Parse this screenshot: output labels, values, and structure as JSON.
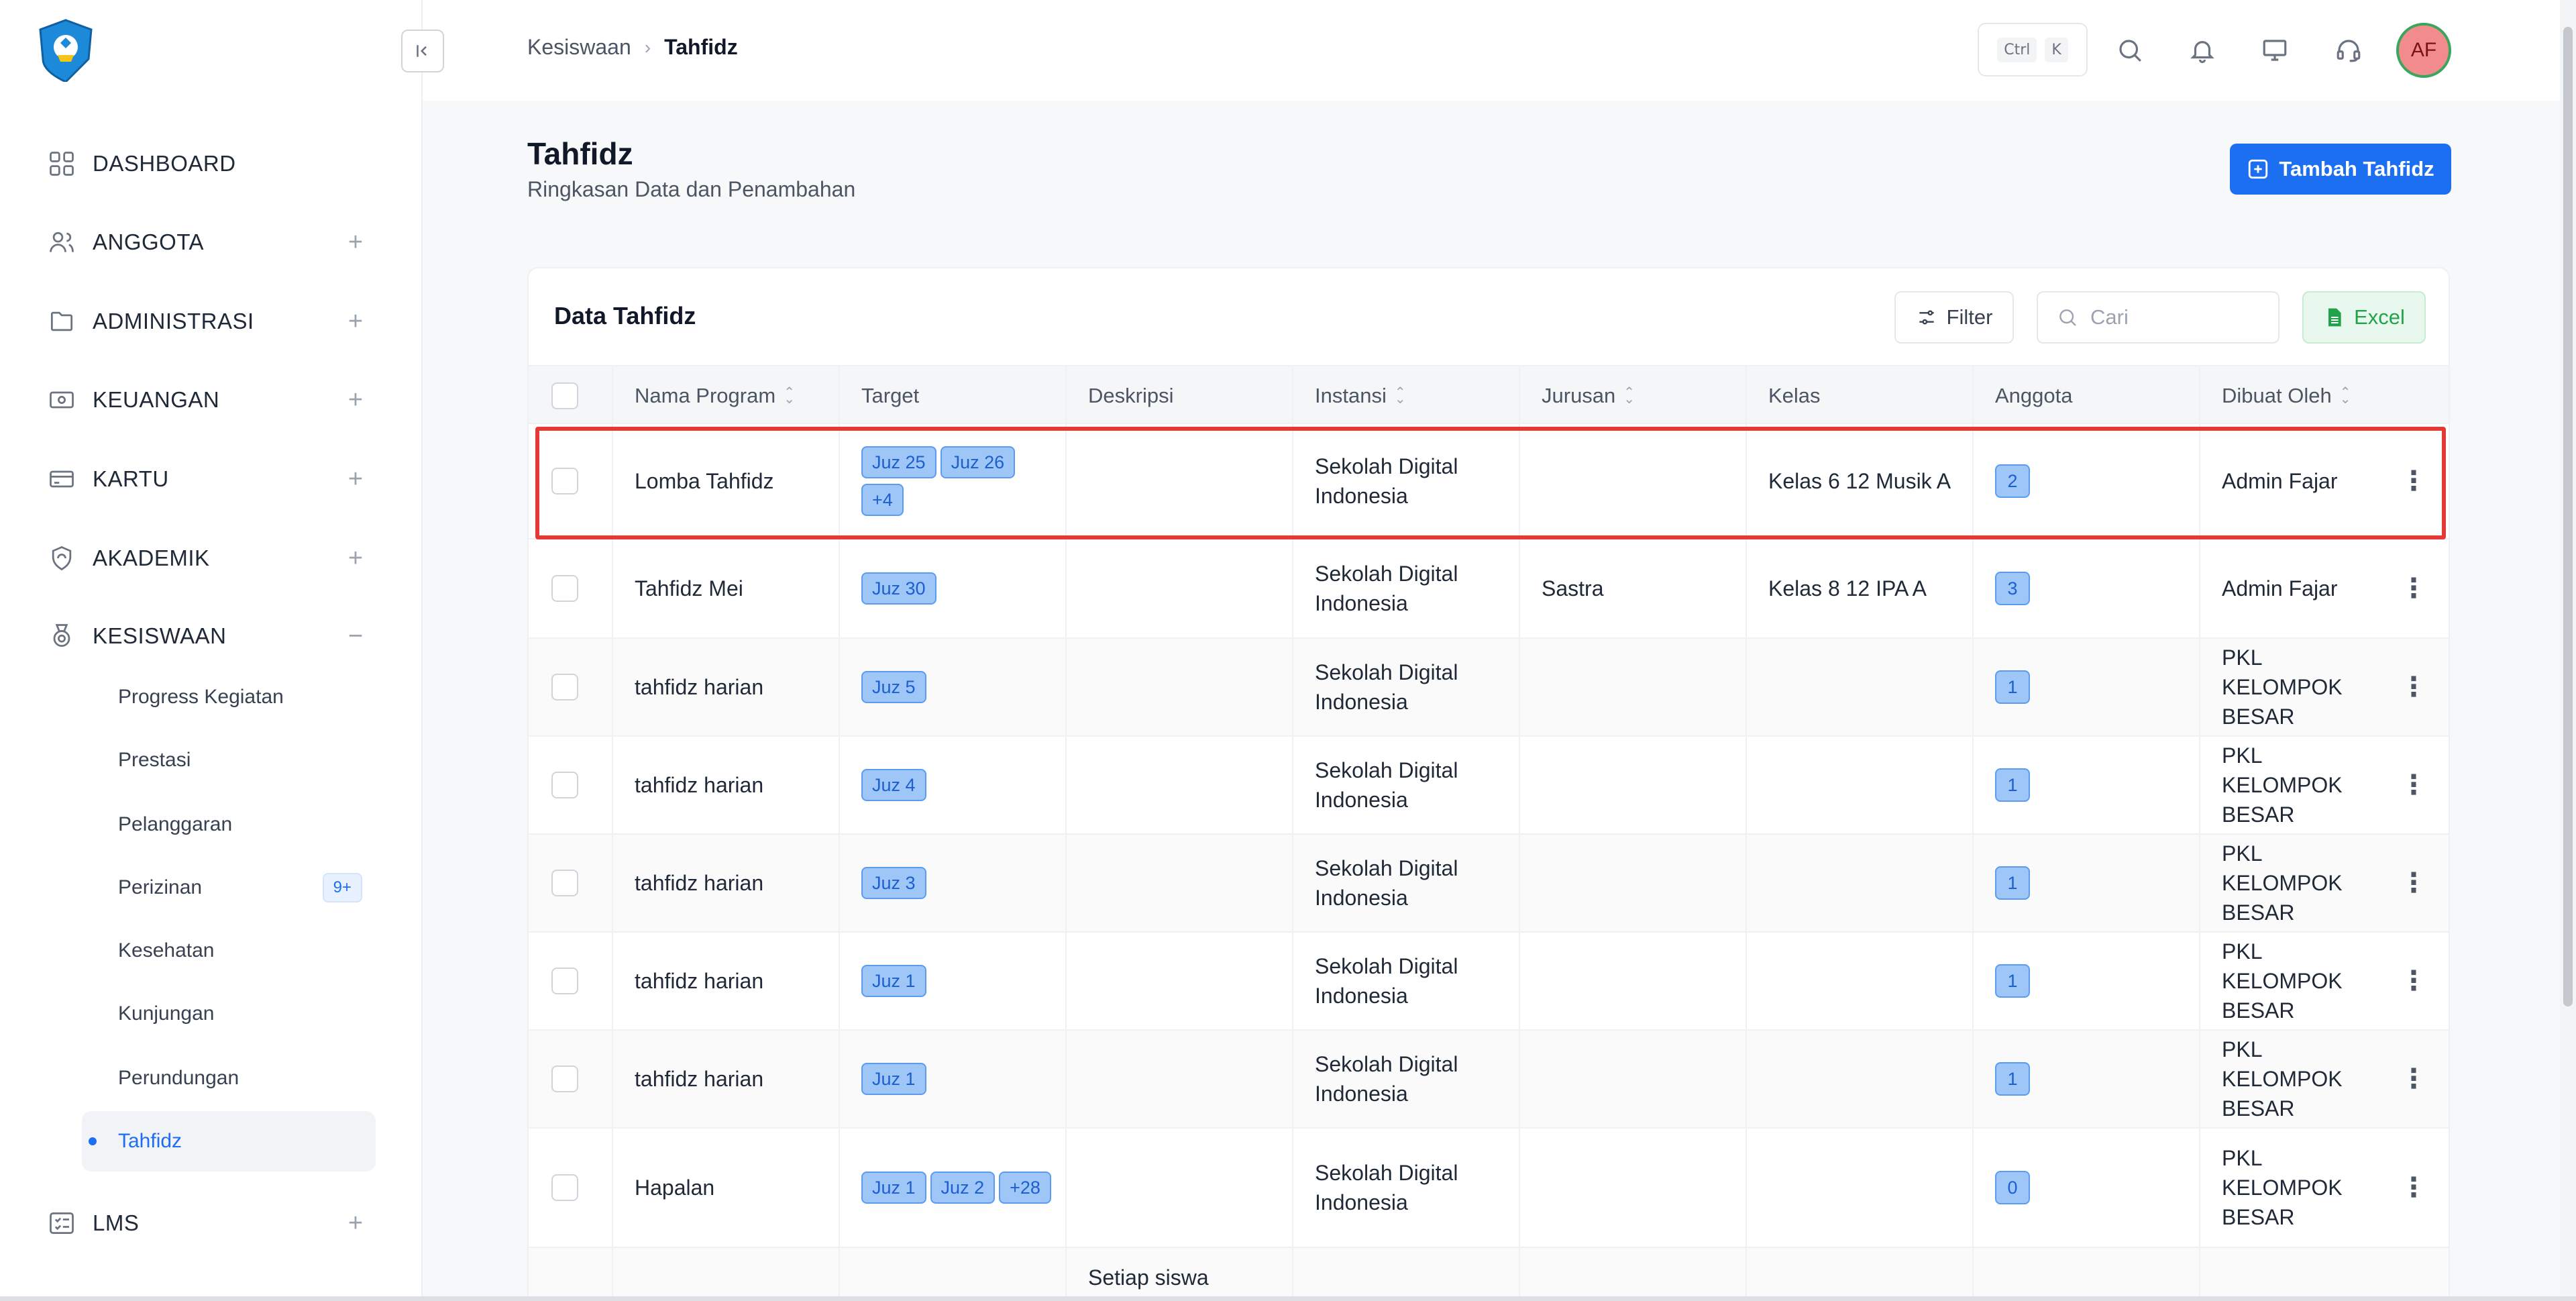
{
  "sidebar": {
    "nav": [
      {
        "label": "DASHBOARD",
        "icon": "grid-icon",
        "toggle": ""
      },
      {
        "label": "ANGGOTA",
        "icon": "users-icon",
        "toggle": "+"
      },
      {
        "label": "ADMINISTRASI",
        "icon": "folder-icon",
        "toggle": "+"
      },
      {
        "label": "KEUANGAN",
        "icon": "money-icon",
        "toggle": "+"
      },
      {
        "label": "KARTU",
        "icon": "card-icon",
        "toggle": "+"
      },
      {
        "label": "AKADEMIK",
        "icon": "shield-icon",
        "toggle": "+"
      },
      {
        "label": "KESISWAAN",
        "icon": "medal-icon",
        "toggle": "−"
      },
      {
        "label": "LMS",
        "icon": "checklist-icon",
        "toggle": "+"
      }
    ],
    "sub": [
      {
        "label": "Progress Kegiatan"
      },
      {
        "label": "Prestasi"
      },
      {
        "label": "Pelanggaran"
      },
      {
        "label": "Perizinan",
        "badge": "9+"
      },
      {
        "label": "Kesehatan"
      },
      {
        "label": "Kunjungan"
      },
      {
        "label": "Perundungan"
      },
      {
        "label": "Tahfidz"
      }
    ]
  },
  "topbar": {
    "breadcrumb": [
      "Kesiswaan",
      "Tahfidz"
    ],
    "kbd": [
      "Ctrl",
      "K"
    ],
    "avatar": "AF"
  },
  "page": {
    "title": "Tahfidz",
    "subtitle": "Ringkasan Data dan Penambahan",
    "add_button": "Tambah Tahfidz"
  },
  "card": {
    "title": "Data Tahfidz",
    "filter": "Filter",
    "search_placeholder": "Cari",
    "excel": "Excel"
  },
  "columns": [
    "Nama Program",
    "Target",
    "Deskripsi",
    "Instansi",
    "Jurusan",
    "Kelas",
    "Anggota",
    "Dibuat Oleh"
  ],
  "rows": [
    {
      "nama": "Lomba Tahfidz",
      "target": [
        "Juz 25",
        "Juz 26",
        "+4"
      ],
      "deskripsi": "",
      "instansi": "Sekolah Digital Indonesia",
      "jurusan": "",
      "kelas": "Kelas 6 12 Musik A",
      "anggota": "2",
      "dibuat": "Admin Fajar"
    },
    {
      "nama": "Tahfidz Mei",
      "target": [
        "Juz 30"
      ],
      "deskripsi": "",
      "instansi": "Sekolah Digital Indonesia",
      "jurusan": "Sastra",
      "kelas": "Kelas 8 12 IPA A",
      "anggota": "3",
      "dibuat": "Admin Fajar"
    },
    {
      "nama": "tahfidz harian",
      "target": [
        "Juz 5"
      ],
      "deskripsi": "",
      "instansi": "Sekolah Digital Indonesia",
      "jurusan": "",
      "kelas": "",
      "anggota": "1",
      "dibuat": "PKL KELOMPOK BESAR"
    },
    {
      "nama": "tahfidz harian",
      "target": [
        "Juz 4"
      ],
      "deskripsi": "",
      "instansi": "Sekolah Digital Indonesia",
      "jurusan": "",
      "kelas": "",
      "anggota": "1",
      "dibuat": "PKL KELOMPOK BESAR"
    },
    {
      "nama": "tahfidz harian",
      "target": [
        "Juz 3"
      ],
      "deskripsi": "",
      "instansi": "Sekolah Digital Indonesia",
      "jurusan": "",
      "kelas": "",
      "anggota": "1",
      "dibuat": "PKL KELOMPOK BESAR"
    },
    {
      "nama": "tahfidz harian",
      "target": [
        "Juz 1"
      ],
      "deskripsi": "",
      "instansi": "Sekolah Digital Indonesia",
      "jurusan": "",
      "kelas": "",
      "anggota": "1",
      "dibuat": "PKL KELOMPOK BESAR"
    },
    {
      "nama": "tahfidz harian",
      "target": [
        "Juz 1"
      ],
      "deskripsi": "",
      "instansi": "Sekolah Digital Indonesia",
      "jurusan": "",
      "kelas": "",
      "anggota": "1",
      "dibuat": "PKL KELOMPOK BESAR"
    },
    {
      "nama": "Hapalan",
      "target": [
        "Juz 1",
        "Juz 2",
        "+28"
      ],
      "deskripsi": "",
      "instansi": "Sekolah Digital Indonesia",
      "jurusan": "",
      "kelas": "",
      "anggota": "0",
      "dibuat": "PKL KELOMPOK BESAR"
    },
    {
      "nama": "",
      "target": [],
      "deskripsi": "Setiap siswa",
      "instansi": "",
      "jurusan": "",
      "kelas": "",
      "anggota": "",
      "dibuat": ""
    }
  ],
  "colors": {
    "primary": "#1d6ff2",
    "excel": "#22a24a",
    "highlight": "#e53935"
  }
}
